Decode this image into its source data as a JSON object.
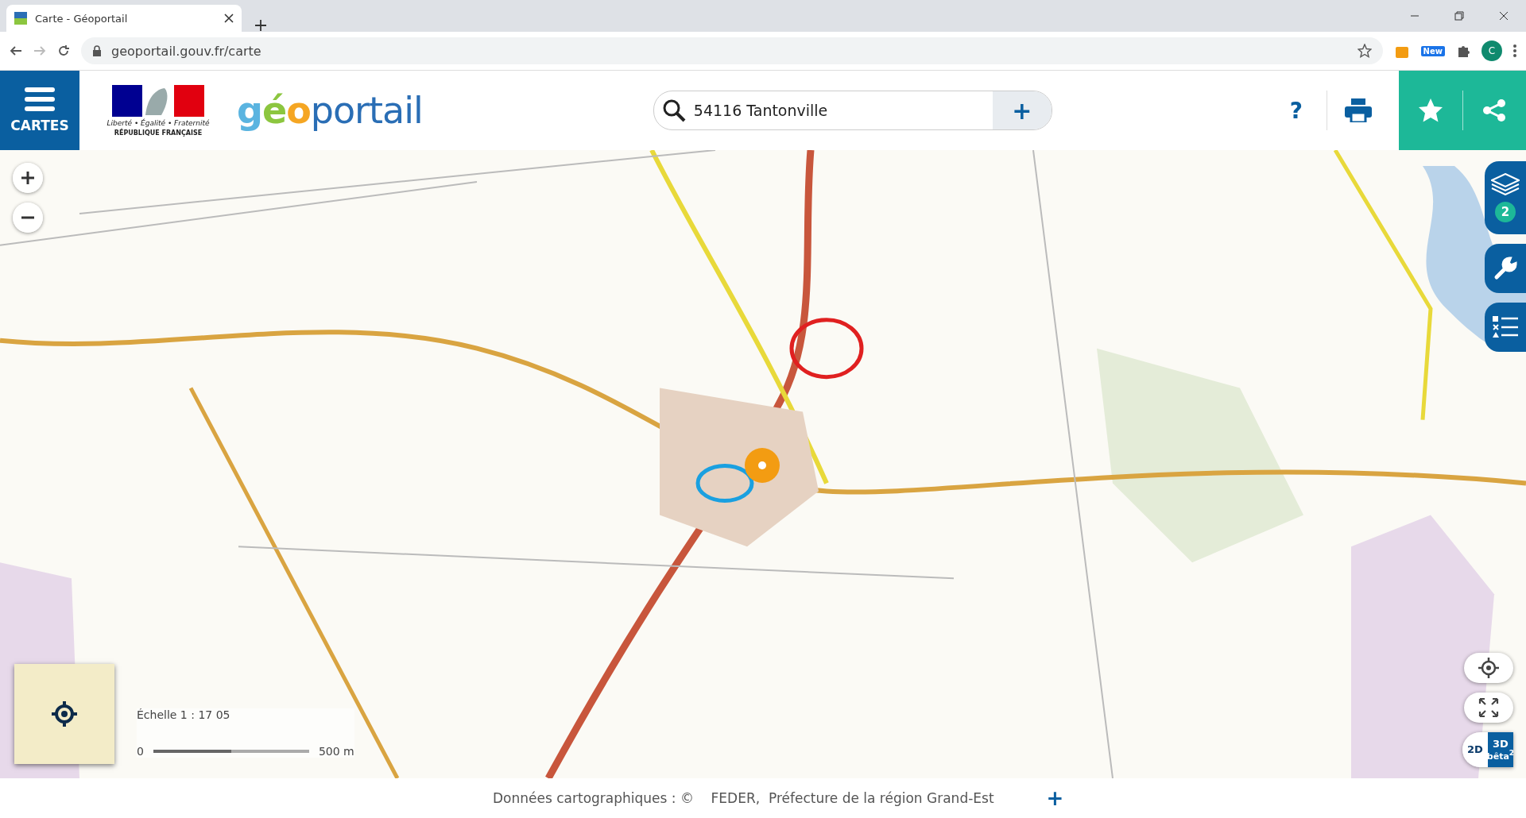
{
  "browser": {
    "tab_title": "Carte - Géoportail",
    "url": "geoportail.gouv.fr/carte",
    "extension_badge": "New",
    "profile_initial": "C"
  },
  "header": {
    "menu_label": "CARTES",
    "republic": {
      "motto": "Liberté • Égalité • Fraternité",
      "name": "RÉPUBLIQUE FRANÇAISE"
    },
    "logo": [
      {
        "text": "g",
        "color": "#5ab4e0"
      },
      {
        "text": "é",
        "color": "#8cc63f"
      },
      {
        "text": "o",
        "color": "#f5a623"
      },
      {
        "text": "portail",
        "color": "#2a6eb5"
      }
    ],
    "search": {
      "value": "54116 Tantonville",
      "add": "+"
    },
    "help": "?"
  },
  "side_tools": [
    {
      "kind": "layers",
      "badge": "2"
    },
    {
      "kind": "tools"
    },
    {
      "kind": "legend"
    }
  ],
  "zoom_controls": [
    {
      "kind": "in"
    },
    {
      "kind": "out"
    }
  ],
  "scale": {
    "label": "Échelle 1 : 17 05",
    "start": "0",
    "end": "500 m"
  },
  "view_modes": [
    {
      "label": "2D",
      "selected": false
    },
    {
      "label": "3D",
      "sub": "bêta$^{2}$",
      "selected": true
    }
  ],
  "footer": {
    "attribution": "Données cartographiques : ©    FEDER,  Préfecture de la région Grand-Est",
    "more": "+"
  }
}
